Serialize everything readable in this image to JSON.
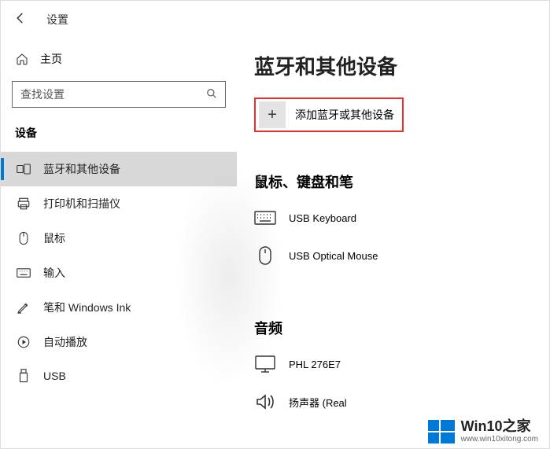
{
  "header": {
    "title": "设置"
  },
  "home": {
    "label": "主页"
  },
  "search": {
    "placeholder": "查找设置"
  },
  "section": {
    "label": "设备"
  },
  "nav": [
    {
      "label": "蓝牙和其他设备",
      "icon": "bluetooth-devices-icon",
      "active": true
    },
    {
      "label": "打印机和扫描仪",
      "icon": "printer-icon"
    },
    {
      "label": "鼠标",
      "icon": "mouse-icon"
    },
    {
      "label": "输入",
      "icon": "keyboard-icon"
    },
    {
      "label": "笔和 Windows Ink",
      "icon": "pen-icon"
    },
    {
      "label": "自动播放",
      "icon": "autoplay-icon"
    },
    {
      "label": "USB",
      "icon": "usb-icon"
    }
  ],
  "page": {
    "title": "蓝牙和其他设备",
    "add_device": "添加蓝牙或其他设备",
    "section_mouse_kb": "鼠标、键盘和笔",
    "section_audio": "音频",
    "devices_input": [
      {
        "name": "USB Keyboard",
        "icon": "keyboard-device-icon"
      },
      {
        "name": "USB Optical Mouse",
        "icon": "mouse-device-icon"
      }
    ],
    "devices_audio": [
      {
        "name": "PHL 276E7",
        "icon": "monitor-icon"
      },
      {
        "name": "扬声器 (Real",
        "icon": "speaker-icon"
      }
    ]
  },
  "watermark": {
    "brand": "Win10",
    "suffix": "之家",
    "url": "www.win10xitong.com"
  }
}
